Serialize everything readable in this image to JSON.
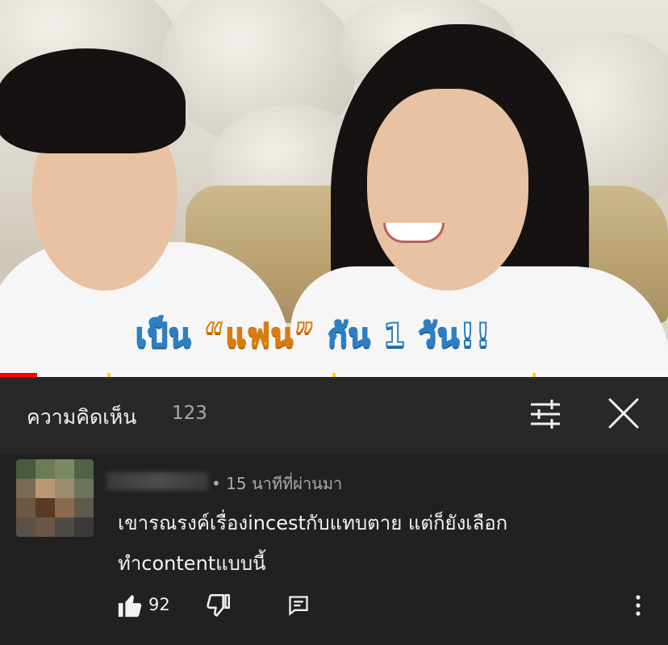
{
  "video": {
    "caption_part1": "เป็น ",
    "caption_quote_open": "“",
    "caption_highlight": "แฟน",
    "caption_quote_close": "”",
    "caption_part2": " กัน 1 วัน!!",
    "progress_fraction": 0.055
  },
  "comments_header": {
    "title": "ความคิดเห็น",
    "count": "123",
    "filter_icon": "sliders-icon",
    "close_icon": "close-icon"
  },
  "comment": {
    "meta": "• 15 นาทีที่ผ่านมา",
    "text_line1": "เขารณรงค์เรื่องincestกับแทบตาย แต่ก็ยังเลือก",
    "text_line2": "ทำcontentแบบนี้",
    "like_count": "92",
    "icons": {
      "like": "thumbs-up-icon",
      "dislike": "thumbs-down-icon",
      "reply": "reply-icon",
      "more": "more-vertical-icon"
    }
  },
  "colors": {
    "background": "#212121",
    "header_background": "#282828",
    "progress_red": "#ff0000",
    "secondary_text": "#aaaaaa"
  }
}
